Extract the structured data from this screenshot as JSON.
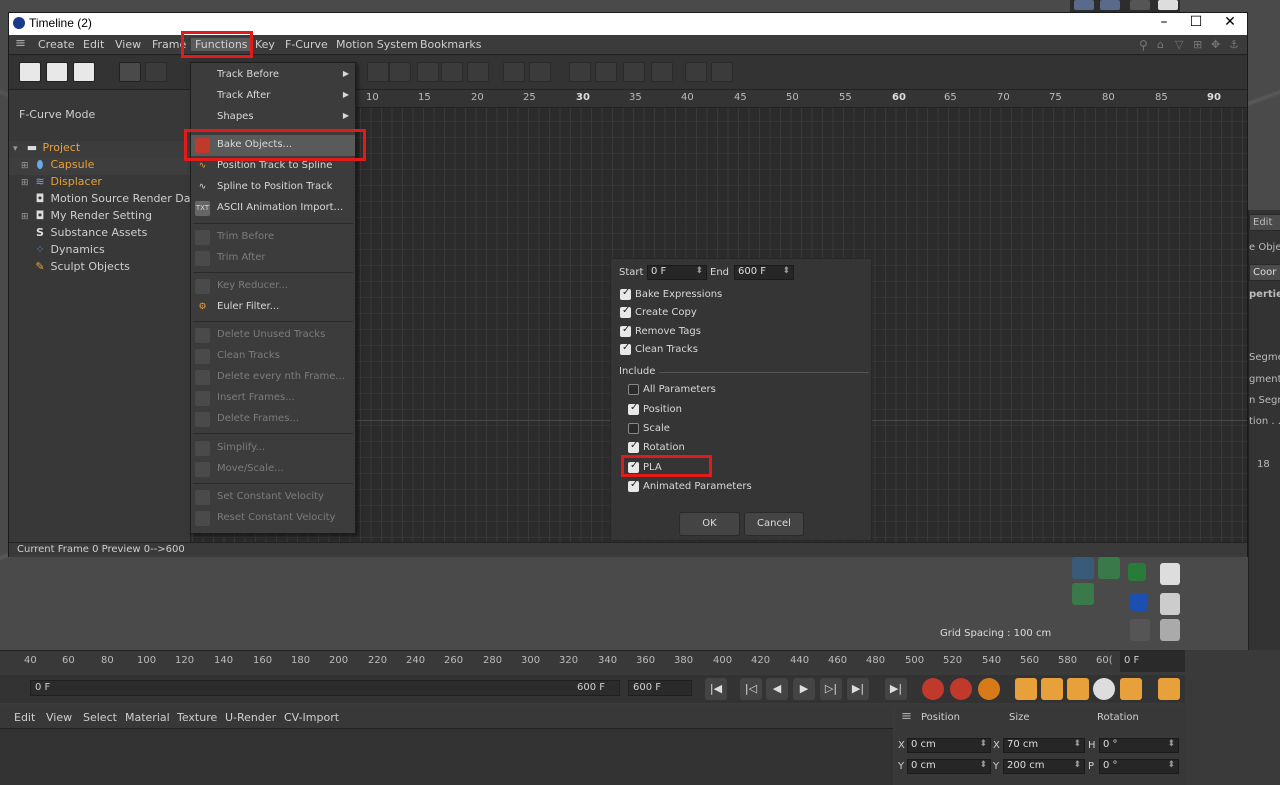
{
  "window": {
    "title": "Timeline (2)"
  },
  "menu": [
    "Create",
    "Edit",
    "View",
    "Frame",
    "Functions",
    "Key",
    "F-Curve",
    "Motion System",
    "Bookmarks"
  ],
  "left_panel": {
    "mode": "F-Curve Mode",
    "tree": [
      {
        "label": "Project",
        "color": "#e8a13a"
      },
      {
        "label": "Capsule",
        "color": "#e8a13a"
      },
      {
        "label": "Displacer",
        "color": "#e8a13a"
      },
      {
        "label": "Motion Source Render Data",
        "color": "#d0d0d0"
      },
      {
        "label": "My Render Setting",
        "color": "#d0d0d0"
      },
      {
        "label": "Substance Assets",
        "color": "#d0d0d0"
      },
      {
        "label": "Dynamics",
        "color": "#d0d0d0"
      },
      {
        "label": "Sculpt Objects",
        "color": "#d0d0d0"
      }
    ]
  },
  "ruler": [
    "10",
    "15",
    "20",
    "25",
    "30",
    "35",
    "40",
    "45",
    "50",
    "55",
    "60",
    "65",
    "70",
    "75",
    "80",
    "85",
    "90"
  ],
  "status": "Current Frame  0  Preview  0-->600",
  "functions_menu": {
    "items": [
      "Track Before",
      "Track After",
      "Shapes",
      "Bake Objects...",
      "Position Track to Spline",
      "Spline to Position Track",
      "ASCII Animation Import...",
      "Trim Before",
      "Trim After",
      "Key Reducer...",
      "Euler Filter...",
      "Delete Unused Tracks",
      "Clean Tracks",
      "Delete every nth Frame...",
      "Insert Frames...",
      "Delete Frames...",
      "Simplify...",
      "Move/Scale...",
      "Set Constant Velocity",
      "Reset Constant Velocity"
    ]
  },
  "dialog": {
    "start_label": "Start",
    "start_value": "0 F",
    "end_label": "End",
    "end_value": "600 F",
    "bake_expressions": "Bake Expressions",
    "create_copy": "Create Copy",
    "remove_tags": "Remove Tags",
    "clean_tracks": "Clean Tracks",
    "include": "Include",
    "all_parameters": "All Parameters",
    "position": "Position",
    "scale": "Scale",
    "rotation": "Rotation",
    "pla": "PLA",
    "animated_parameters": "Animated Parameters",
    "ok": "OK",
    "cancel": "Cancel"
  },
  "right_panel": [
    "Edit",
    "e Objec",
    "Coor",
    "perties",
    "Segme",
    "gments",
    "n Segm",
    "tion . .",
    "18"
  ],
  "viewport": {
    "grid_spacing": "Grid Spacing : 100 cm"
  },
  "bottom_ruler": [
    "40",
    "60",
    "80",
    "100",
    "120",
    "140",
    "160",
    "180",
    "200",
    "220",
    "240",
    "260",
    "280",
    "300",
    "320",
    "340",
    "360",
    "380",
    "400",
    "420",
    "440",
    "460",
    "480",
    "500",
    "520",
    "540",
    "560",
    "580",
    "60("
  ],
  "frame_field": "0 F",
  "transport": {
    "current": "0 F",
    "end": "600 F",
    "end_field": "600 F"
  },
  "material_menu": [
    "Edit",
    "View",
    "Select",
    "Material",
    "Texture",
    "U-Render",
    "CV-Import"
  ],
  "coords": {
    "headers": [
      "Position",
      "Size",
      "Rotation"
    ],
    "rows": [
      [
        "X",
        "0 cm",
        "X",
        "70 cm",
        "H",
        "0 °"
      ],
      [
        "Y",
        "0 cm",
        "Y",
        "200 cm",
        "P",
        "0 °"
      ]
    ]
  },
  "colors": {
    "highlight": "#e21a1a",
    "accent_orange": "#e8a13a"
  }
}
